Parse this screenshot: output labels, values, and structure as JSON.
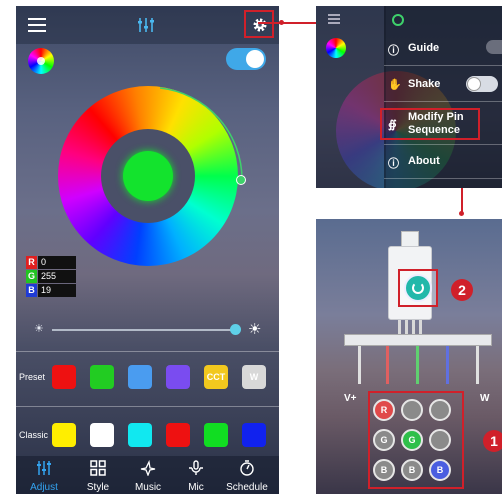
{
  "main": {
    "rgb": [
      {
        "tag": "R",
        "value": "0",
        "color": "#e02020"
      },
      {
        "tag": "G",
        "value": "255",
        "color": "#22c422"
      },
      {
        "tag": "B",
        "value": "19",
        "color": "#1f3bd6"
      }
    ],
    "current_color": "#13e32d",
    "preset": {
      "label": "Preset",
      "swatches": [
        {
          "color": "#ee1111",
          "text": ""
        },
        {
          "color": "#22cc22",
          "text": ""
        },
        {
          "color": "#4a9cf0",
          "text": ""
        },
        {
          "color": "#7a4cf0",
          "text": ""
        },
        {
          "color": "#f2c81e",
          "text": "CCT"
        },
        {
          "color": "#d8d8d8",
          "text": "W"
        }
      ]
    },
    "classic": {
      "label": "Classic",
      "swatches": [
        {
          "color": "#ffee00"
        },
        {
          "color": "#ffffff"
        },
        {
          "color": "#11e8f0"
        },
        {
          "color": "#ee1111"
        },
        {
          "color": "#11dd22"
        },
        {
          "color": "#1122ee"
        }
      ]
    },
    "nav": [
      {
        "label": "Adjust",
        "icon": "sliders-icon",
        "active": true
      },
      {
        "label": "Style",
        "icon": "grid-icon",
        "active": false
      },
      {
        "label": "Music",
        "icon": "music-icon",
        "active": false
      },
      {
        "label": "Mic",
        "icon": "mic-icon",
        "active": false
      },
      {
        "label": "Schedule",
        "icon": "timer-icon",
        "active": false
      }
    ]
  },
  "menu": {
    "items": [
      {
        "label": "Guide",
        "icon": "help-icon"
      },
      {
        "label": "Shake",
        "icon": "shake-icon"
      },
      {
        "label_line1": "Modify Pin",
        "label_line2": "Sequence",
        "icon": "pin-icon"
      },
      {
        "label": "About",
        "icon": "info-icon"
      }
    ]
  },
  "pin": {
    "label_left": "V+",
    "label_right": "W",
    "grid": [
      [
        {
          "text": "R",
          "fill": "#e04a4a"
        },
        {
          "text": "",
          "fill": "#8a8a8a"
        },
        {
          "text": "",
          "fill": "#8a8a8a"
        }
      ],
      [
        {
          "text": "G",
          "fill": "#8a8a8a"
        },
        {
          "text": "G",
          "fill": "#2fbf4a"
        },
        {
          "text": "",
          "fill": "#8a8a8a"
        }
      ],
      [
        {
          "text": "B",
          "fill": "#8a8a8a"
        },
        {
          "text": "B",
          "fill": "#8a8a8a"
        },
        {
          "text": "B",
          "fill": "#4a5ee0"
        }
      ]
    ],
    "badges": [
      "2",
      "1"
    ]
  },
  "colors": {
    "accent": "#33a3f0",
    "highlight": "#d0202a"
  }
}
